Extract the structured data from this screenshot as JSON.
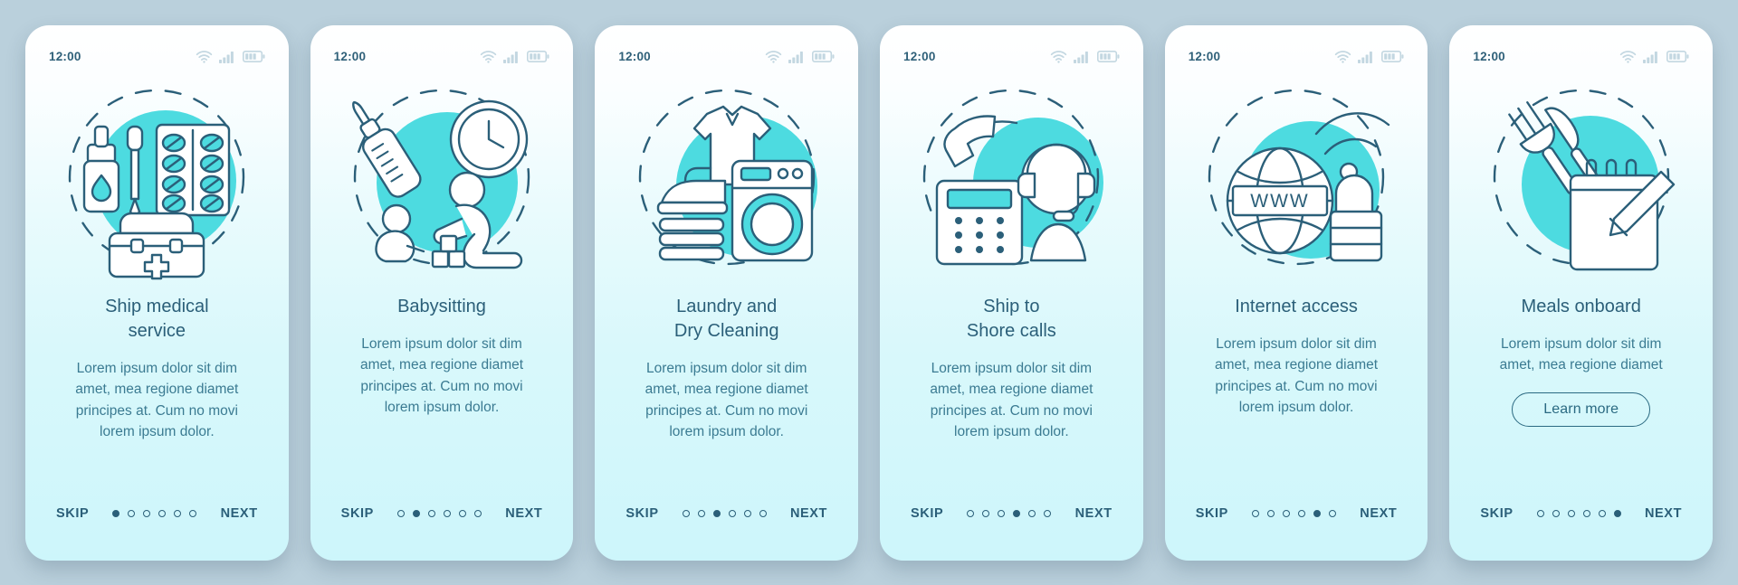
{
  "theme": {
    "background": "#bad0dc",
    "card_top": "#ffffff",
    "card_bottom": "#cdf6fb",
    "accent": "#4ddbe0",
    "ink": "#2b5f79",
    "body_ink": "#3b7b92"
  },
  "statusbar": {
    "time": "12:00",
    "icons": [
      "wifi-icon",
      "signal-icon",
      "battery-icon"
    ]
  },
  "footer": {
    "skip_label": "SKIP",
    "next_label": "NEXT",
    "dot_count": 6
  },
  "cards": [
    {
      "illustration": "medical-kit-icon",
      "title": "Ship medical\nservice",
      "body": "Lorem ipsum dolor sit dim\namet, mea regione diamet\nprincipes at. Cum no movi\nlorem ipsum dolor.",
      "active_dot": 1,
      "cta": null
    },
    {
      "illustration": "babysitting-icon",
      "title": "Babysitting",
      "body": "Lorem ipsum dolor sit dim\namet, mea regione diamet\nprincipes at. Cum no movi\nlorem ipsum dolor.",
      "active_dot": 2,
      "cta": null
    },
    {
      "illustration": "laundry-icon",
      "title": "Laundry and\nDry Cleaning",
      "body": "Lorem ipsum dolor sit dim\namet, mea regione diamet\nprincipes at. Cum no movi\nlorem ipsum dolor.",
      "active_dot": 3,
      "cta": null
    },
    {
      "illustration": "shore-calls-icon",
      "title": "Ship to\nShore calls",
      "body": "Lorem ipsum dolor sit dim\namet, mea regione diamet\nprincipes at. Cum no movi\nlorem ipsum dolor.",
      "active_dot": 4,
      "cta": null
    },
    {
      "illustration": "internet-access-icon",
      "title": "Internet access",
      "body": "Lorem ipsum dolor sit dim\namet, mea regione diamet\nprincipes at. Cum no movi\nlorem ipsum dolor.",
      "active_dot": 5,
      "cta": null
    },
    {
      "illustration": "meals-onboard-icon",
      "title": "Meals onboard",
      "body": "Lorem ipsum dolor sit dim\namet, mea regione diamet",
      "active_dot": 6,
      "cta": "Learn more"
    }
  ]
}
